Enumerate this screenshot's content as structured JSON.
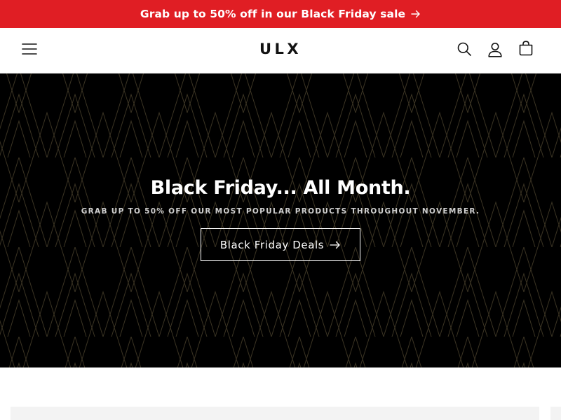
{
  "announcement": {
    "text": "Grab up to 50% off in our Black Friday sale",
    "arrow_icon": "arrow-right-icon",
    "background_color": "#e01e24"
  },
  "header": {
    "logo": "ULX",
    "icons": {
      "menu": "hamburger-menu-icon",
      "search": "search-icon",
      "account": "account-icon",
      "cart": "cart-icon"
    }
  },
  "hero": {
    "title": "Black Friday... All Month.",
    "subtitle": "GRAB UP TO 50% OFF OUR MOST POPULAR PRODUCTS THROUGHOUT NOVEMBER.",
    "cta_label": "Black Friday Deals",
    "cta_icon": "arrow-right-icon",
    "background_color": "#000000",
    "pattern_color": "#3b3423"
  }
}
